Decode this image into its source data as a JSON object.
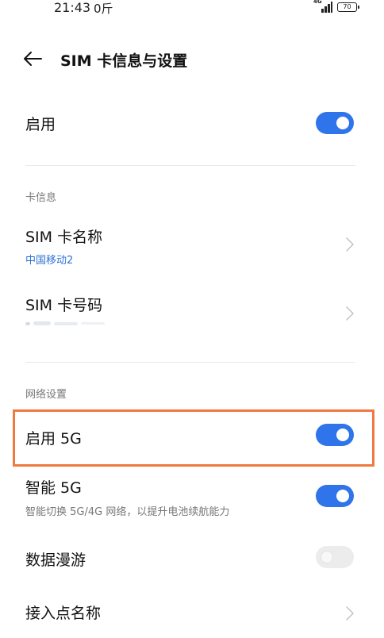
{
  "status_bar": {
    "time": "21:43",
    "sub": "0斤",
    "network": "4G",
    "battery": "70"
  },
  "header": {
    "title": "SIM 卡信息与设置",
    "back_icon": "arrow-left-icon"
  },
  "enable": {
    "label": "启用",
    "on": true
  },
  "card_info": {
    "section_label": "卡信息",
    "sim_name": {
      "label": "SIM 卡名称",
      "value": "中国移动2"
    },
    "sim_number": {
      "label": "SIM 卡号码"
    }
  },
  "network_settings": {
    "section_label": "网络设置",
    "enable_5g": {
      "label": "启用 5G",
      "on": true
    },
    "smart_5g": {
      "label": "智能 5G",
      "description": "智能切换 5G/4G 网络，以提升电池续航能力",
      "on": true
    },
    "data_roaming": {
      "label": "数据漫游",
      "on": false
    },
    "apn": {
      "label": "接入点名称"
    }
  },
  "colors": {
    "toggle_on": "#2f74ea",
    "toggle_off": "#ececec",
    "highlight": "#ee7a3e",
    "sub_blue": "#2f73d6"
  }
}
